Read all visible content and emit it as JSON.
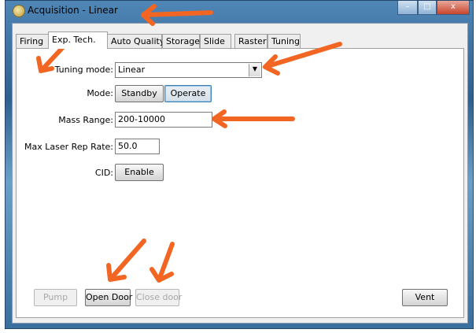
{
  "window": {
    "title": "Acquisition - Linear",
    "controls": {
      "minimize": "–",
      "maximize": "□",
      "close": "x"
    }
  },
  "tabs": [
    {
      "label": "Firing"
    },
    {
      "label": "Exp. Tech."
    },
    {
      "label": "Auto Quality"
    },
    {
      "label": "Storage"
    },
    {
      "label": "Slide"
    },
    {
      "label": "Raster"
    },
    {
      "label": "Tuning"
    }
  ],
  "active_tab": "Exp. Tech.",
  "form": {
    "tuning_mode": {
      "label": "Tuning mode:",
      "value": "Linear"
    },
    "mode": {
      "label": "Mode:",
      "standby": "Standby",
      "operate": "Operate",
      "selected": "Operate"
    },
    "mass_range": {
      "label": "Mass Range:",
      "value": "200-10000"
    },
    "max_laser_rep_rate": {
      "label": "Max Laser Rep Rate:",
      "value": "50.0"
    },
    "cid": {
      "label": "CID:",
      "button": "Enable"
    }
  },
  "bottom_buttons": {
    "pump": "Pump",
    "open_door": "Open Door",
    "close_door": "Close door",
    "vent": "Vent"
  },
  "annotations": {
    "arrow_color": "#f26522"
  }
}
